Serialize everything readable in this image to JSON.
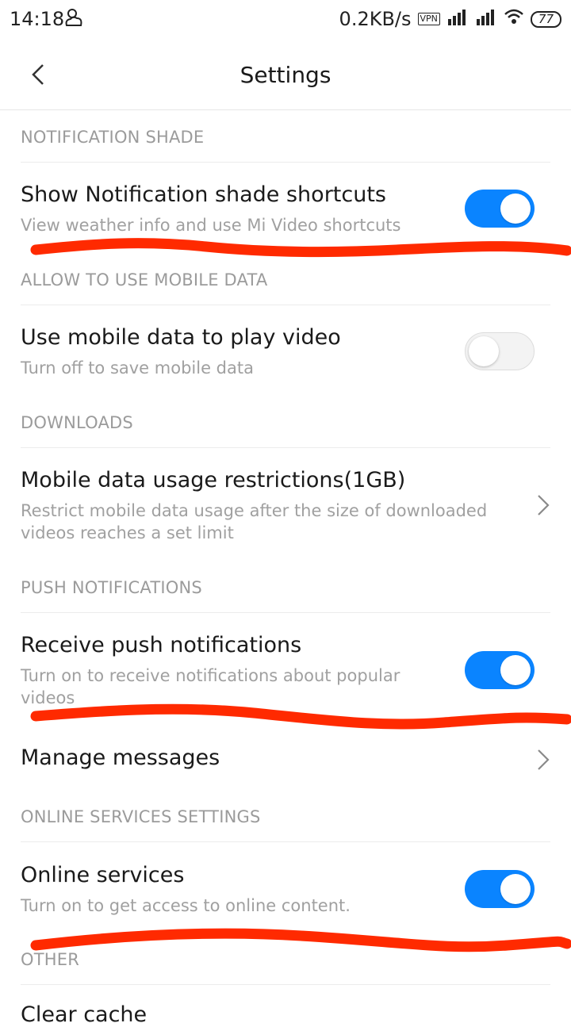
{
  "status": {
    "time": "14:18",
    "speed": "0.2KB/s",
    "vpn": "VPN",
    "battery": "77"
  },
  "header": {
    "title": "Settings"
  },
  "sections": {
    "notification_shade": "NOTIFICATION SHADE",
    "mobile_data": "ALLOW TO USE MOBILE DATA",
    "downloads": "DOWNLOADS",
    "push": "PUSH NOTIFICATIONS",
    "online": "ONLINE SERVICES SETTINGS",
    "other": "OTHER"
  },
  "rows": {
    "shade_shortcuts": {
      "title": "Show Notification shade shortcuts",
      "subtitle": "View weather info and use Mi Video shortcuts",
      "enabled": true
    },
    "mobile_video": {
      "title": "Use mobile data to play video",
      "subtitle": "Turn off to save mobile data",
      "enabled": false
    },
    "usage_restrictions": {
      "title": "Mobile data usage restrictions(1GB)",
      "subtitle": "Restrict mobile data usage after the size of downloaded videos reaches a set limit"
    },
    "push_notifications": {
      "title": "Receive push notifications",
      "subtitle": "Turn on to receive notifications about popular videos",
      "enabled": true
    },
    "manage_messages": {
      "title": "Manage messages"
    },
    "online_services": {
      "title": "Online services",
      "subtitle": "Turn on to get access to online content.",
      "enabled": true
    },
    "clear_cache": {
      "title": "Clear cache"
    }
  },
  "colors": {
    "accent": "#0a84ff",
    "annotation": "#ff2a00"
  }
}
